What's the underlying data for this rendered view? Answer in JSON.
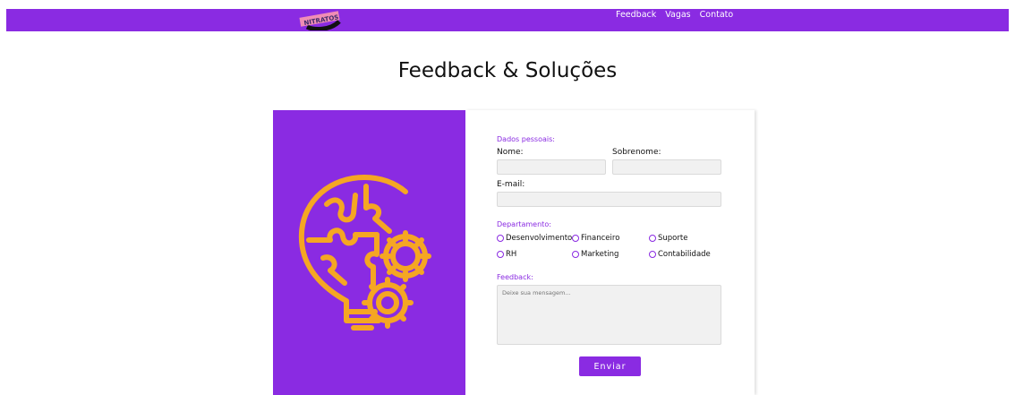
{
  "brand": {
    "logo_text": "NITRATOS"
  },
  "nav": {
    "links": [
      {
        "label": "Feedback"
      },
      {
        "label": "Vagas"
      },
      {
        "label": "Contato"
      }
    ]
  },
  "page": {
    "title": "Feedback & Soluções"
  },
  "illustration": {
    "icon": "lightbulb-puzzle-gears-icon",
    "color": "#f5a623"
  },
  "colors": {
    "primary": "#8a2be2",
    "accent": "#f5a623",
    "input_bg": "#f1f1f1"
  },
  "form": {
    "personal_section": "Dados pessoais:",
    "name_label": "Nome:",
    "surname_label": "Sobrenome:",
    "email_label": "E-mail:",
    "department_section": "Departamento:",
    "departments": [
      {
        "label": "Desenvolvimento"
      },
      {
        "label": "Financeiro"
      },
      {
        "label": "Suporte"
      },
      {
        "label": "RH"
      },
      {
        "label": "Marketing"
      },
      {
        "label": "Contabilidade"
      }
    ],
    "feedback_section": "Feedback:",
    "message_placeholder": "Deixe sua mensagem...",
    "submit_label": "Enviar"
  }
}
